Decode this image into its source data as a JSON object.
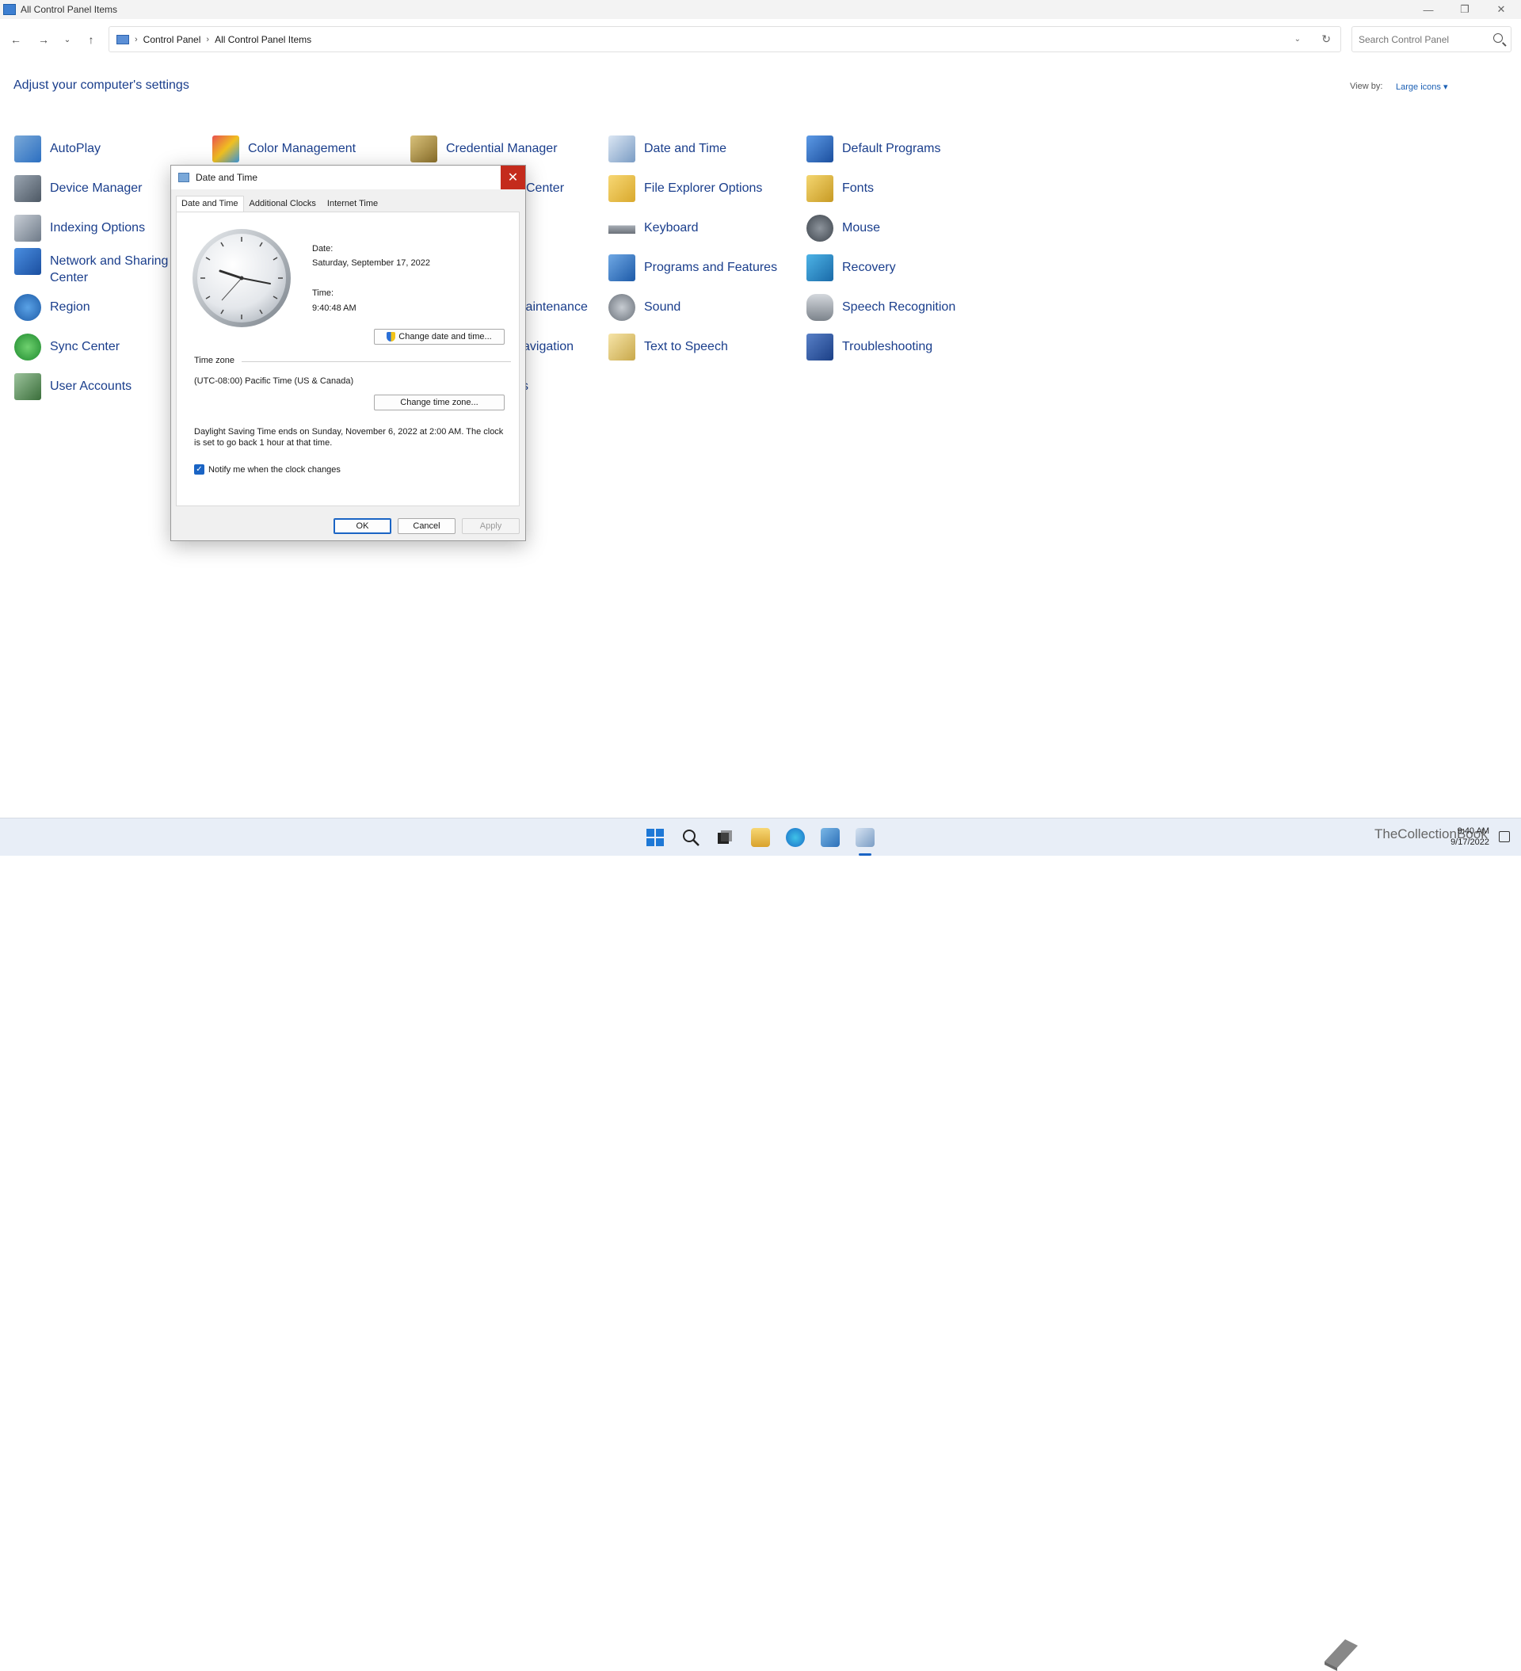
{
  "window": {
    "title": "All Control Panel Items"
  },
  "address": {
    "crumbs": [
      "Control Panel",
      "All Control Panel Items"
    ],
    "search_placeholder": "Search Control Panel"
  },
  "page": {
    "heading": "Adjust your computer's settings",
    "view_by_label": "View by:",
    "view_by_value": "Large icons"
  },
  "items": {
    "autoplay": "AutoPlay",
    "color_management": "Color Management",
    "credential_manager": "Credential Manager",
    "date_and_time": "Date and Time",
    "default_programs": "Default Programs",
    "device_manager": "Device Manager",
    "center_partial": "Center",
    "file_explorer_options": "File Explorer Options",
    "fonts": "Fonts",
    "indexing_options": "Indexing Options",
    "keyboard": "Keyboard",
    "mouse": "Mouse",
    "network_sharing": "Network and Sharing Center",
    "programs_features": "Programs and Features",
    "recovery": "Recovery",
    "region": "Region",
    "maintenance_partial": "laintenance",
    "sound": "Sound",
    "speech_recognition": "Speech Recognition",
    "sync_center": "Sync Center",
    "navigation_partial": "avigation",
    "text_to_speech": "Text to Speech",
    "troubleshooting": "Troubleshooting",
    "user_accounts": "User Accounts",
    "s_partial": "s"
  },
  "dialog": {
    "title": "Date and Time",
    "tabs": [
      "Date and Time",
      "Additional Clocks",
      "Internet Time"
    ],
    "date_label": "Date:",
    "date_value": "Saturday, September 17, 2022",
    "time_label": "Time:",
    "time_value": "9:40:48 AM",
    "change_datetime_button": "Change date and time...",
    "timezone_label": "Time zone",
    "timezone_value": "(UTC-08:00) Pacific Time (US & Canada)",
    "change_timezone_button": "Change time zone...",
    "dst_text": "Daylight Saving Time ends on Sunday, November 6, 2022 at 2:00 AM. The clock is set to go back 1 hour at that time.",
    "notify_label": "Notify me when the clock changes",
    "ok": "OK",
    "cancel": "Cancel",
    "apply": "Apply"
  },
  "taskbar": {
    "time": "9:40 AM",
    "date": "9/17/2022",
    "watermark": "TheCollectionBook"
  },
  "colors": {
    "link_blue": "#1a3e8c",
    "close_red": "#c42b1c",
    "accent": "#1a64c4"
  }
}
